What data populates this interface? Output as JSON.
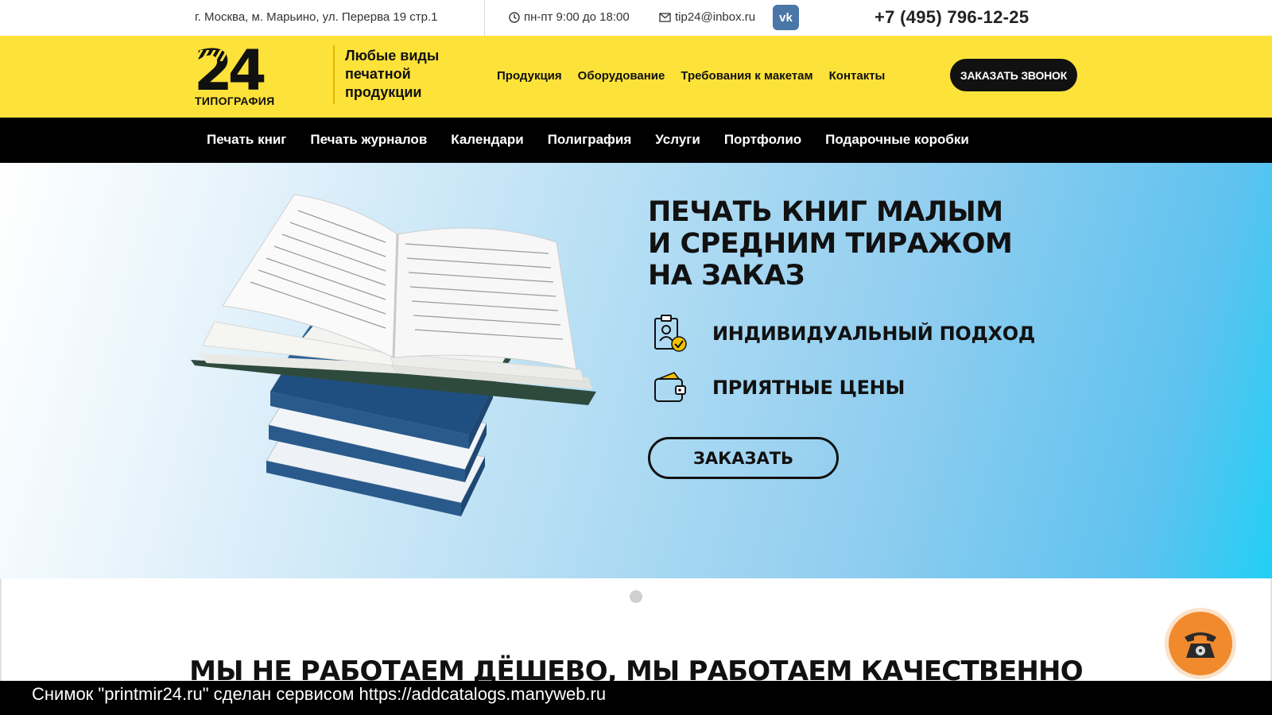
{
  "topbar": {
    "address": "г. Москва, м. Марьино, ул. Перерва 19 стр.1",
    "hours": "пн-пт 9:00 до 18:00",
    "email": "tip24@inbox.ru",
    "vk_label": "vk",
    "phone": "+7 (495) 796-12-25"
  },
  "header": {
    "logo_number": "24",
    "logo_sub": "ТИПОГРАФИЯ",
    "slogan": "Любые виды печатной продукции",
    "nav": [
      "Продукция",
      "Оборудование",
      "Требования к макетам",
      "Контакты"
    ],
    "callback_button": "ЗАКАЗАТЬ ЗВОНОК"
  },
  "catnav": [
    "Печать книг",
    "Печать журналов",
    "Календари",
    "Полиграфия",
    "Услуги",
    "Портфолио",
    "Подарочные коробки"
  ],
  "hero": {
    "title": "ПЕЧАТЬ КНИГ МАЛЫМ И СРЕДНИМ ТИРАЖОМ НА ЗАКАЗ",
    "features": [
      {
        "icon": "clipboard-user-check-icon",
        "text": "ИНДИВИДУАЛЬНЫЙ ПОДХОД"
      },
      {
        "icon": "wallet-icon",
        "text": "ПРИЯТНЫЕ ЦЕНЫ"
      }
    ],
    "order_button": "ЗАКАЗАТЬ"
  },
  "section_heading": "МЫ НЕ РАБОТАЕМ ДЁШЕВО, МЫ РАБОТАЕМ КАЧЕСТВЕННО",
  "caption": "Снимок \"printmir24.ru\" сделан сервисом https://addcatalogs.manyweb.ru",
  "colors": {
    "brand_yellow": "#fde23a",
    "phone_orange": "#f08a2c",
    "vk_blue": "#4a76a8"
  }
}
